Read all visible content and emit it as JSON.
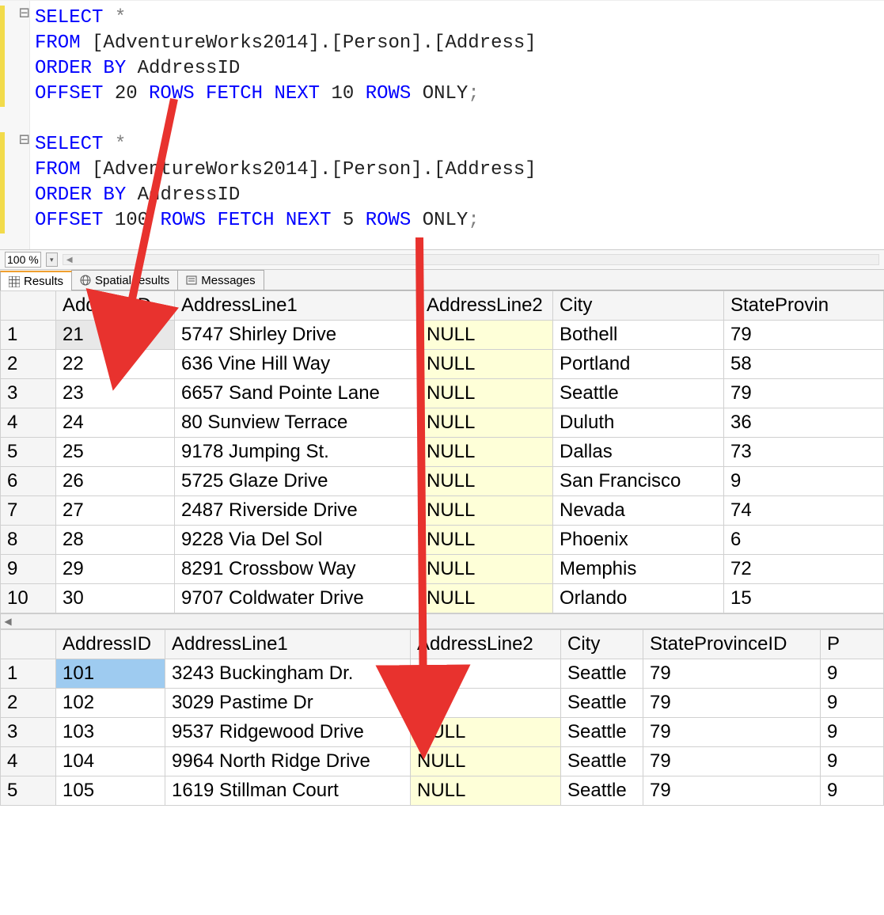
{
  "editor": {
    "zoom": "100 %",
    "collapse1": "⊟",
    "collapse2": "⊟",
    "query1": {
      "l1": {
        "select": "SELECT",
        "star": " *"
      },
      "l2": {
        "from": "FROM",
        "rest": " [AdventureWorks2014].[Person].[Address]"
      },
      "l3": {
        "orderby": "ORDER",
        "by": " BY",
        "rest": " AddressID"
      },
      "l4": {
        "offset": "OFFSET",
        "n1": " 20 ",
        "rows": "ROWS",
        "sp": " ",
        "fetch": "FETCH",
        "sp2": " ",
        "next": "NEXT",
        "n2": " 10 ",
        "rows2": "ROWS",
        "only": " ONLY",
        "semi": ";"
      }
    },
    "query2": {
      "l1": {
        "select": "SELECT",
        "star": " *"
      },
      "l2": {
        "from": "FROM",
        "rest": " [AdventureWorks2014].[Person].[Address]"
      },
      "l3": {
        "orderby": "ORDER",
        "by": " BY",
        "rest": " AddressID"
      },
      "l4": {
        "offset": "OFFSET",
        "n1": " 100 ",
        "rows": "ROWS",
        "sp": " ",
        "fetch": "FETCH",
        "sp2": " ",
        "next": "NEXT",
        "n2": " 5 ",
        "rows2": "ROWS",
        "only": " ONLY",
        "semi": ";"
      }
    }
  },
  "tabs": {
    "results": "Results",
    "spatial": "Spatial results",
    "messages": "Messages"
  },
  "grid1": {
    "headers": {
      "c1": "AddressID",
      "c2": "AddressLine1",
      "c3": "AddressLine2",
      "c4": "City",
      "c5": "StateProvin"
    },
    "rows": [
      {
        "n": "1",
        "c1": "21",
        "c2": "5747 Shirley Drive",
        "c3": "NULL",
        "c4": "Bothell",
        "c5": "79"
      },
      {
        "n": "2",
        "c1": "22",
        "c2": "636 Vine Hill Way",
        "c3": "NULL",
        "c4": "Portland",
        "c5": "58"
      },
      {
        "n": "3",
        "c1": "23",
        "c2": "6657 Sand Pointe Lane",
        "c3": "NULL",
        "c4": "Seattle",
        "c5": "79"
      },
      {
        "n": "4",
        "c1": "24",
        "c2": "80 Sunview Terrace",
        "c3": "NULL",
        "c4": "Duluth",
        "c5": "36"
      },
      {
        "n": "5",
        "c1": "25",
        "c2": "9178 Jumping St.",
        "c3": "NULL",
        "c4": "Dallas",
        "c5": "73"
      },
      {
        "n": "6",
        "c1": "26",
        "c2": "5725 Glaze Drive",
        "c3": "NULL",
        "c4": "San Francisco",
        "c5": "9"
      },
      {
        "n": "7",
        "c1": "27",
        "c2": "2487 Riverside Drive",
        "c3": "NULL",
        "c4": "Nevada",
        "c5": "74"
      },
      {
        "n": "8",
        "c1": "28",
        "c2": "9228 Via Del Sol",
        "c3": "NULL",
        "c4": "Phoenix",
        "c5": "6"
      },
      {
        "n": "9",
        "c1": "29",
        "c2": "8291 Crossbow Way",
        "c3": "NULL",
        "c4": "Memphis",
        "c5": "72"
      },
      {
        "n": "10",
        "c1": "30",
        "c2": "9707 Coldwater Drive",
        "c3": "NULL",
        "c4": "Orlando",
        "c5": "15"
      }
    ]
  },
  "grid2": {
    "headers": {
      "c1": "AddressID",
      "c2": "AddressLine1",
      "c3": "AddressLine2",
      "c4": "City",
      "c5": "StateProvinceID",
      "c6": "P"
    },
    "rows": [
      {
        "n": "1",
        "c1": "101",
        "c2": "3243 Buckingham Dr.",
        "c3": "# 207",
        "c4": "Seattle",
        "c5": "79",
        "c6": "9"
      },
      {
        "n": "2",
        "c1": "102",
        "c2": "3029 Pastime Dr",
        "c3": "# 2",
        "c4": "Seattle",
        "c5": "79",
        "c6": "9"
      },
      {
        "n": "3",
        "c1": "103",
        "c2": "9537 Ridgewood Drive",
        "c3": "NULL",
        "c4": "Seattle",
        "c5": "79",
        "c6": "9"
      },
      {
        "n": "4",
        "c1": "104",
        "c2": "9964 North Ridge Drive",
        "c3": "NULL",
        "c4": "Seattle",
        "c5": "79",
        "c6": "9"
      },
      {
        "n": "5",
        "c1": "105",
        "c2": "1619 Stillman Court",
        "c3": "NULL",
        "c4": "Seattle",
        "c5": "79",
        "c6": "9"
      }
    ]
  }
}
